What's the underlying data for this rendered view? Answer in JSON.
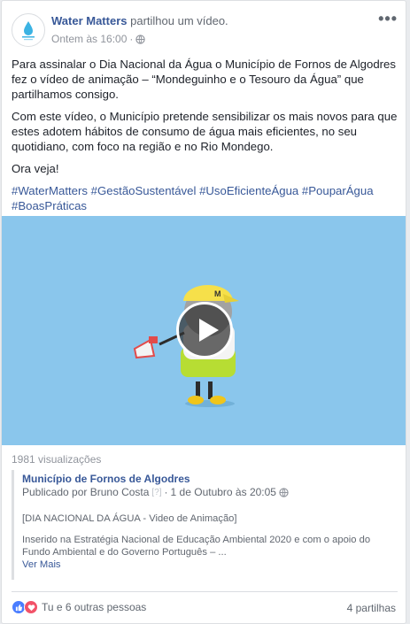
{
  "post": {
    "author": "Water Matters",
    "action": "partilhou um vídeo.",
    "time": "Ontem às 16:00",
    "time_separator": "·",
    "privacy_icon": "globe-icon",
    "more_label": "•••",
    "paragraphs": [
      "Para assinalar o Dia Nacional da Água o Município de Fornos de Algodres fez o vídeo de animação – “Mondeguinho e o Tesouro da Água” que partilhamos consigo.",
      "Com este vídeo, o Município pretende sensibilizar os mais novos para que estes adotem hábitos de consumo de água mais eficientes, no seu quotidiano, com foco na região e no Rio Mondego.",
      "Ora veja!"
    ],
    "hashtags": "#WaterMatters #GestãoSustentável #UsoEficienteÁgua #PouparÁgua #BoasPráticas"
  },
  "video": {
    "views": "1981 visualizações",
    "play_icon": "play-icon",
    "background_color": "#8ac6ec"
  },
  "shared": {
    "page_name": "Município de Fornos de Algodres",
    "published_by": "Publicado por Bruno Costa",
    "help_marker": "[?]",
    "separator": "·",
    "date": "1 de Outubro às 20:05",
    "video_title": "[DIA NACIONAL DA ÁGUA - Video de Animação]",
    "description": "Inserido na Estratégia Nacional de Educação Ambiental 2020 e com o apoio do Fundo Ambiental e do Governo Português – ...",
    "see_more": "Ver Mais"
  },
  "footer": {
    "reactions_text": "Tu e 6 outras pessoas",
    "shares": "4 partilhas",
    "reaction_icons": [
      "like-icon",
      "love-icon"
    ]
  },
  "colors": {
    "link": "#385898",
    "muted": "#90949c",
    "video_bg": "#8ac6ec",
    "like": "#4a7dff",
    "love": "#f25268"
  }
}
